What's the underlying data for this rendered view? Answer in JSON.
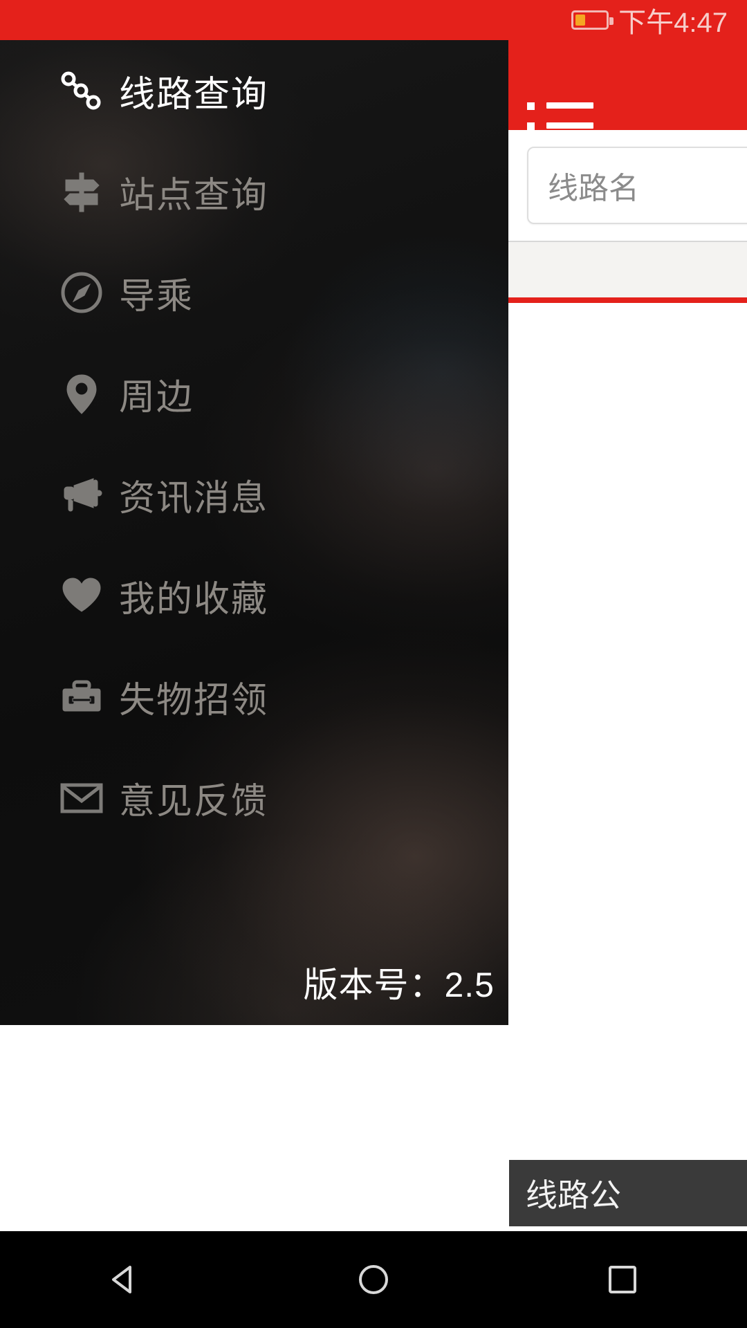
{
  "status_bar": {
    "time": "下午4:47",
    "battery_icon": "battery-low-icon",
    "battery_level_pct": 20,
    "background_color": "#E4211B"
  },
  "app": {
    "header": {
      "menu_icon": "list-menu-icon",
      "background_color": "#E4211B"
    },
    "search": {
      "placeholder": "线路名",
      "value": ""
    },
    "toast": {
      "text": "线路公"
    }
  },
  "drawer": {
    "background_color": "#111111",
    "active_index": 0,
    "items": [
      {
        "label": "线路查询",
        "icon": "route-nodes-icon",
        "active": true
      },
      {
        "label": "站点查询",
        "icon": "signpost-icon",
        "active": false
      },
      {
        "label": "导乘",
        "icon": "compass-icon",
        "active": false
      },
      {
        "label": "周边",
        "icon": "map-pin-icon",
        "active": false
      },
      {
        "label": "资讯消息",
        "icon": "megaphone-icon",
        "active": false
      },
      {
        "label": "我的收藏",
        "icon": "heart-icon",
        "active": false
      },
      {
        "label": "失物招领",
        "icon": "briefcase-icon",
        "active": false
      },
      {
        "label": "意见反馈",
        "icon": "envelope-icon",
        "active": false
      }
    ],
    "version_text": "版本号：2.5"
  },
  "nav_bar": {
    "back": "back-triangle-icon",
    "home": "home-circle-icon",
    "recents": "recents-square-icon"
  }
}
